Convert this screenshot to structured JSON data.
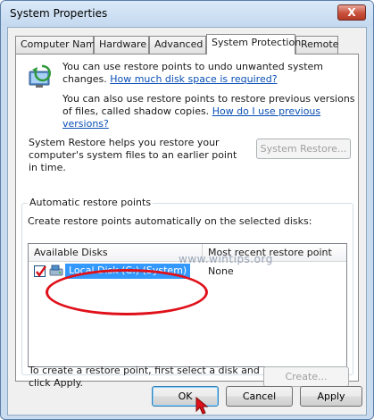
{
  "window": {
    "title": "System Properties",
    "close_label": "X"
  },
  "tabs": [
    {
      "label": "Computer Name"
    },
    {
      "label": "Hardware"
    },
    {
      "label": "Advanced"
    },
    {
      "label": "System Protection",
      "active": true
    },
    {
      "label": "Remote"
    }
  ],
  "intro": {
    "line1_text": "You can use restore points to undo unwanted system changes.",
    "line1_link": "How much disk space is required?",
    "line2_text": "You can also use restore points to restore previous versions of files, called shadow copies.",
    "line2_link": "How do I use previous versions?"
  },
  "system_restore": {
    "description": "System Restore helps you restore your computer's system files to an earlier point in time.",
    "button_label": "System Restore..."
  },
  "automatic_restore_points": {
    "group_label": "Automatic restore points",
    "instruction": "Create restore points automatically on the selected disks:",
    "columns": [
      "Available Disks",
      "Most recent restore point"
    ],
    "rows": [
      {
        "disk": "Local Disk (C:) (System)",
        "recent": "None",
        "checked": true
      }
    ]
  },
  "create": {
    "text": "To create a restore point, first select a disk and click Apply.",
    "button_label": "Create..."
  },
  "footer": {
    "ok": "OK",
    "cancel": "Cancel",
    "apply": "Apply"
  },
  "watermark": "www.wintips.org",
  "colors": {
    "selection": "#3399ff",
    "highlight_annotation": "#e0101a",
    "link": "#0a4fb5"
  }
}
